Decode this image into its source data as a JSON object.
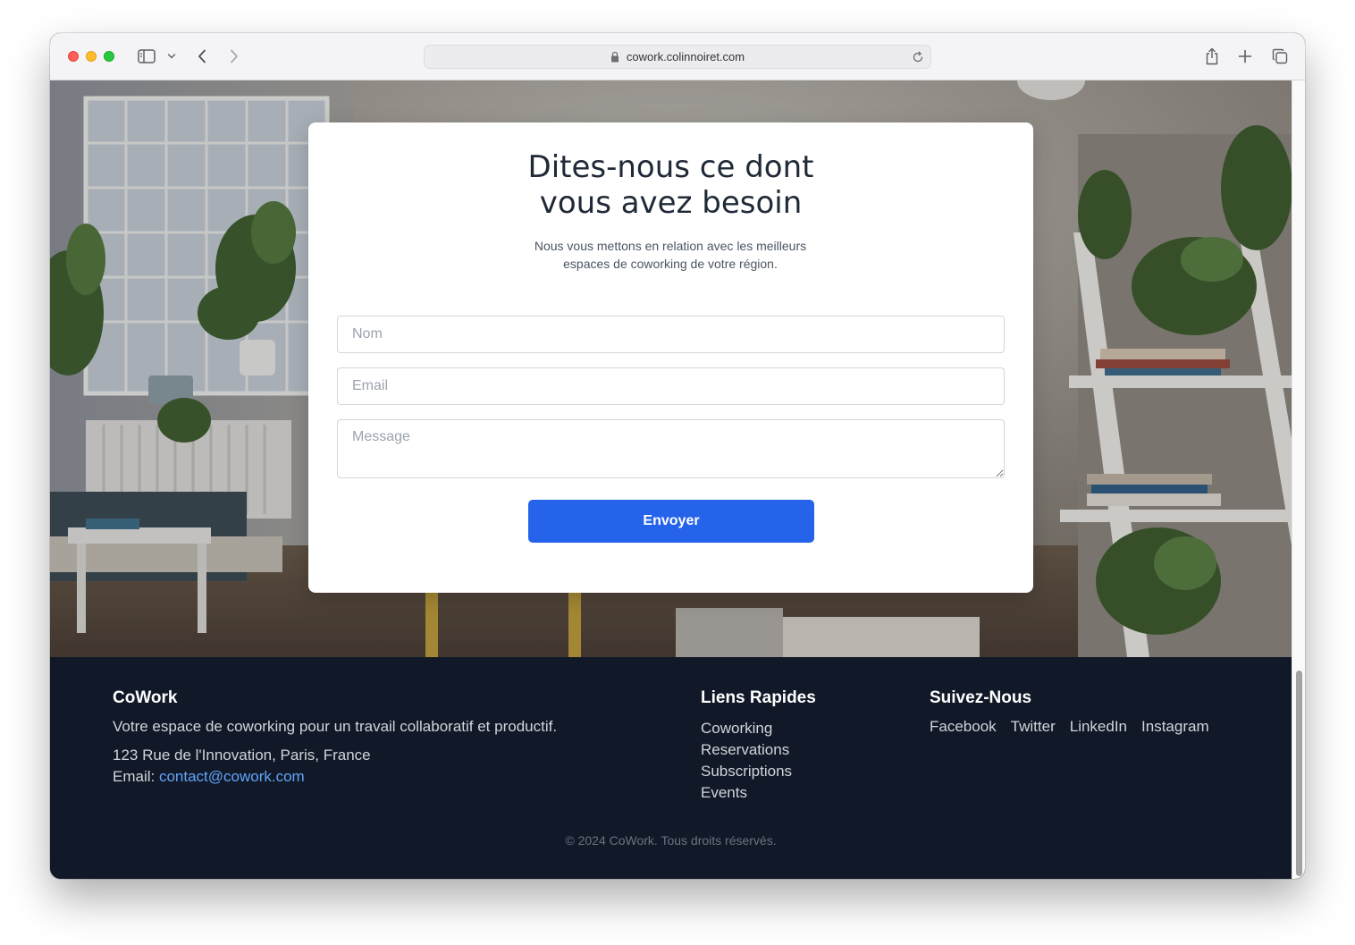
{
  "browser": {
    "url": "cowork.colinnoiret.com"
  },
  "form": {
    "title_line1": "Dites-nous ce dont",
    "title_line2": "vous avez besoin",
    "subtitle_line1": "Nous vous mettons en relation avec les meilleurs",
    "subtitle_line2": "espaces de coworking de votre région.",
    "name_placeholder": "Nom",
    "email_placeholder": "Email",
    "message_placeholder": "Message",
    "submit_label": "Envoyer"
  },
  "footer": {
    "brand": "CoWork",
    "tagline": "Votre espace de coworking pour un travail collaboratif et productif.",
    "address": "123 Rue de l'Innovation, Paris, France",
    "email_label": "Email:",
    "email": "contact@cowork.com",
    "links_heading": "Liens Rapides",
    "links": [
      "Coworking",
      "Reservations",
      "Subscriptions",
      "Events"
    ],
    "social_heading": "Suivez-Nous",
    "social": [
      "Facebook",
      "Twitter",
      "LinkedIn",
      "Instagram"
    ],
    "copyright": "© 2024 CoWork. Tous droits réservés."
  },
  "colors": {
    "accent": "#2563eb",
    "footer_bg": "#111827",
    "email_link": "#60a5fa"
  }
}
